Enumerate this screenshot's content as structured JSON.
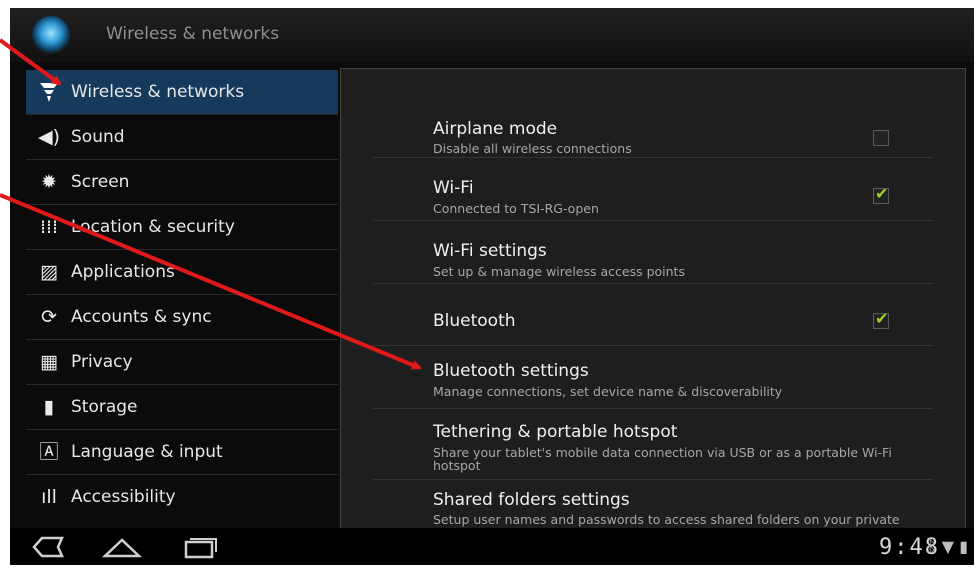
{
  "action_bar": {
    "title": "Wireless & networks",
    "app_icon": "settings-app-icon"
  },
  "sidebar": {
    "items": [
      {
        "label": "Wireless & networks",
        "icon": "wireless-icon",
        "selected": true
      },
      {
        "label": "Sound",
        "icon": "sound-icon"
      },
      {
        "label": "Screen",
        "icon": "screen-icon"
      },
      {
        "label": "Location & security",
        "icon": "location-icon"
      },
      {
        "label": "Applications",
        "icon": "applications-icon"
      },
      {
        "label": "Accounts & sync",
        "icon": "sync-icon"
      },
      {
        "label": "Privacy",
        "icon": "privacy-icon"
      },
      {
        "label": "Storage",
        "icon": "storage-icon"
      },
      {
        "label": "Language & input",
        "icon": "language-icon"
      },
      {
        "label": "Accessibility",
        "icon": "accessibility-icon"
      }
    ]
  },
  "preferences": [
    {
      "title": "Airplane mode",
      "summary": "Disable all wireless connections",
      "checkbox": true,
      "checked": false
    },
    {
      "title": "Wi-Fi",
      "summary": "Connected to TSI-RG-open",
      "checkbox": true,
      "checked": true
    },
    {
      "title": "Wi-Fi settings",
      "summary": "Set up & manage wireless access points"
    },
    {
      "title": "Bluetooth",
      "summary": "",
      "checkbox": true,
      "checked": true
    },
    {
      "title": "Bluetooth settings",
      "summary": "Manage connections, set device name & discoverability"
    },
    {
      "title": "Tethering & portable hotspot",
      "summary": "Share your tablet's mobile data connection via USB or as a portable Wi-Fi hotspot"
    },
    {
      "title": "Shared folders settings",
      "summary": "Setup user names and passwords to access shared folders on your private"
    }
  ],
  "system_bar": {
    "time": "9:48",
    "status_icons": [
      "bluetooth-icon",
      "wifi-signal-icon",
      "battery-icon"
    ]
  },
  "colors": {
    "selected_bg": "#163a5c",
    "check_green": "#9bd425",
    "arrow_red": "#e0191b"
  }
}
